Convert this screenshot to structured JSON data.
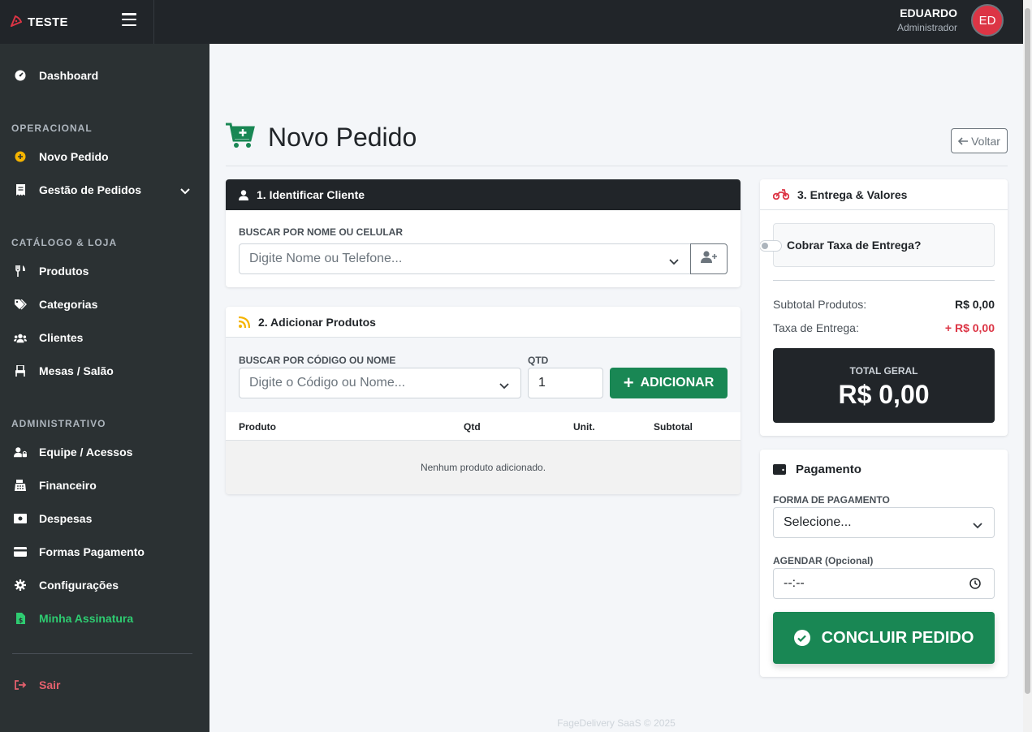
{
  "topbar": {
    "brand": "TESTE",
    "user_name": "EDUARDO",
    "user_role": "Administrador",
    "avatar_initials": "ED"
  },
  "sidebar": {
    "dashboard": "Dashboard",
    "section_operacional": "OPERACIONAL",
    "novo_pedido": "Novo Pedido",
    "gestao_pedidos": "Gestão de Pedidos",
    "section_catalogo": "CATÁLOGO & LOJA",
    "produtos": "Produtos",
    "categorias": "Categorias",
    "clientes": "Clientes",
    "mesas": "Mesas / Salão",
    "section_admin": "ADMINISTRATIVO",
    "equipe": "Equipe / Acessos",
    "financeiro": "Financeiro",
    "despesas": "Despesas",
    "formas_pagamento": "Formas Pagamento",
    "configuracoes": "Configurações",
    "assinatura": "Minha Assinatura",
    "sair": "Sair"
  },
  "page": {
    "title": "Novo Pedido",
    "back_button": "Voltar"
  },
  "cliente": {
    "header": "1. Identificar Cliente",
    "search_label": "BUSCAR POR NOME OU CELULAR",
    "search_placeholder": "Digite Nome ou Telefone..."
  },
  "produtos": {
    "header": "2. Adicionar Produtos",
    "search_label": "BUSCAR POR CÓDIGO OU NOME",
    "search_placeholder": "Digite o Código ou Nome...",
    "qty_label": "QTD",
    "qty_value": "1",
    "add_button": "ADICIONAR",
    "columns": [
      "Produto",
      "Qtd",
      "Unit.",
      "Subtotal"
    ],
    "empty_message": "Nenhum produto adicionado."
  },
  "entrega": {
    "header": "3. Entrega & Valores",
    "toggle_label": "Cobrar Taxa de Entrega?",
    "toggle_on": false,
    "subtotal_label": "Subtotal Produtos:",
    "subtotal_value": "R$ 0,00",
    "taxa_label": "Taxa de Entrega:",
    "taxa_value": "+ R$ 0,00",
    "total_label": "TOTAL GERAL",
    "total_value": "R$ 0,00"
  },
  "pagamento": {
    "header": "Pagamento",
    "forma_label": "FORMA DE PAGAMENTO",
    "forma_value": "Selecione...",
    "agendar_label": "AGENDAR (Opcional)",
    "agendar_value": "--:--",
    "concluir_button": "CONCLUIR PEDIDO"
  },
  "footer": "FageDelivery SaaS © 2025",
  "colors": {
    "accent_green": "#198754",
    "danger": "#dc3545",
    "dark": "#212529",
    "sidebar": "#2b3133",
    "highlight_green": "#2ecc71"
  }
}
